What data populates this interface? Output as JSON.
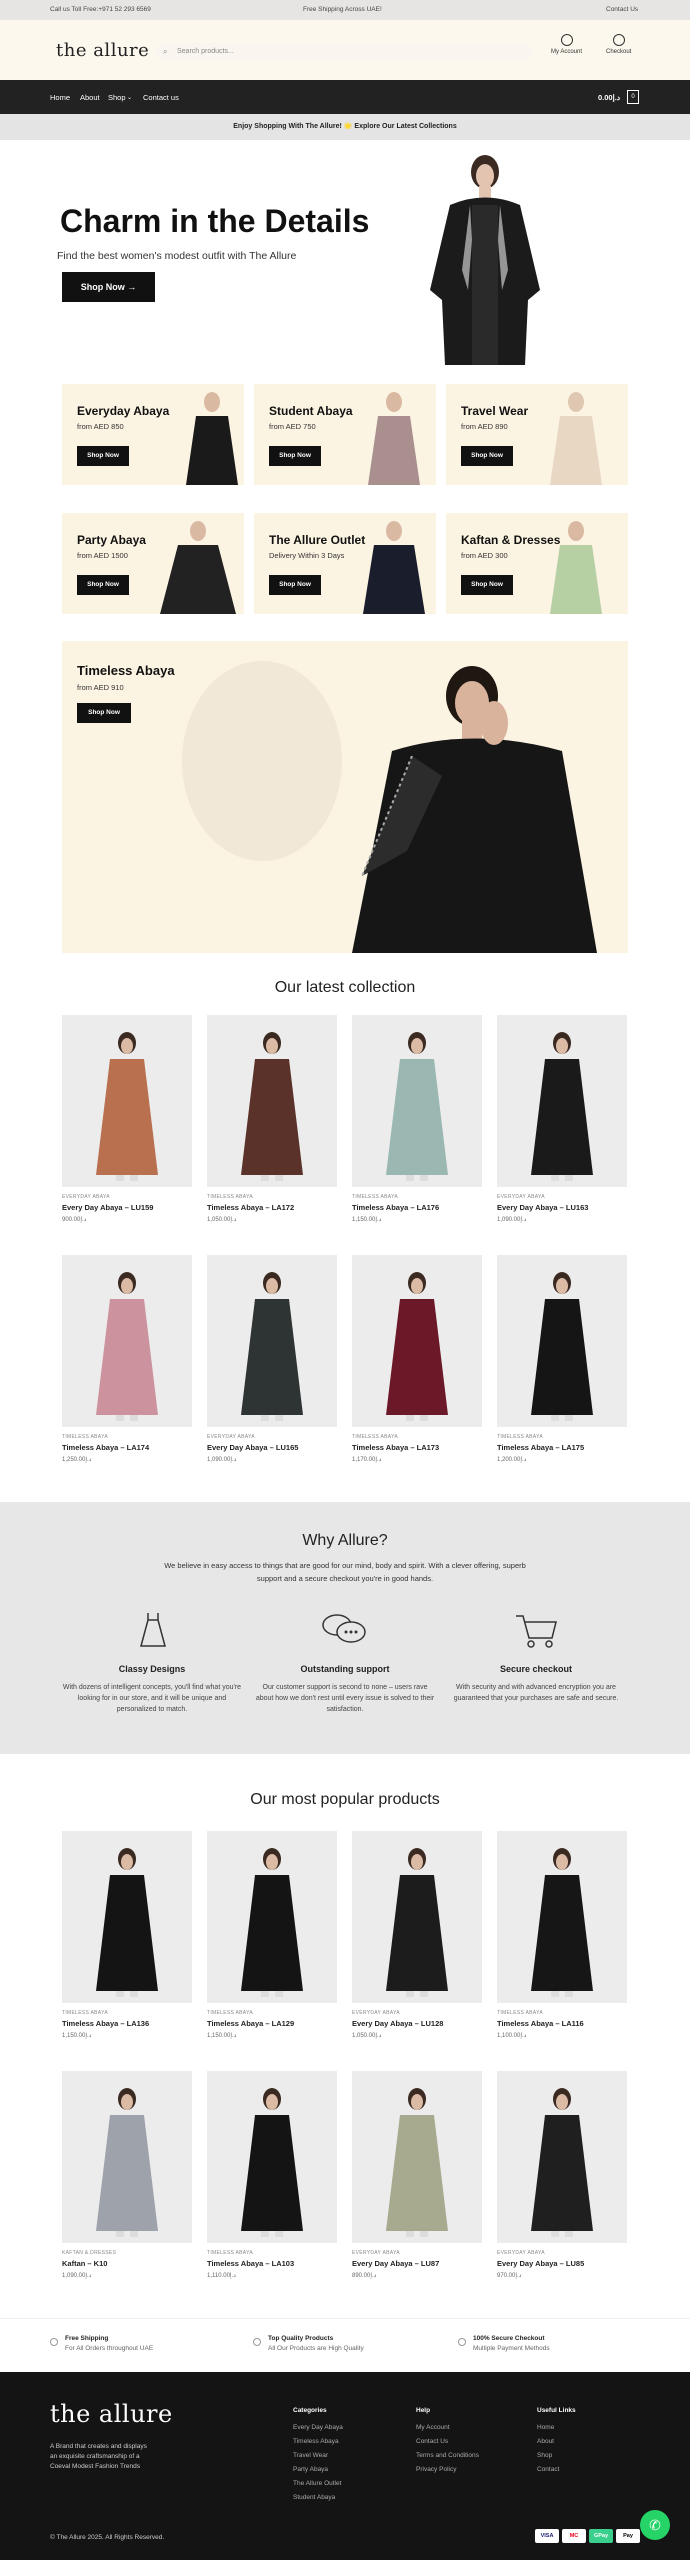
{
  "topbar": {
    "call": "Call us Toll Free:+971 52 293 6569",
    "shipping": "Free Shipping Across UAE!",
    "contact": "Contact Us"
  },
  "header": {
    "logo": "the allure",
    "search_placeholder": "Search products...",
    "account": "My Account",
    "checkout": "Checkout"
  },
  "nav": {
    "items": [
      "Home",
      "About",
      "Shop",
      "Contact us"
    ],
    "cart_total": "0.00د.إ",
    "cart_count": "0"
  },
  "notice": "Enjoy Shopping With The Allure! 🌟 Explore Our Latest Collections",
  "hero": {
    "title": "Charm in the Details",
    "subtitle": "Find the best women's modest outfit with The Allure",
    "button": "Shop Now →"
  },
  "categories": [
    {
      "title": "Everyday Abaya",
      "sub": "from AED 850",
      "btn": "Shop Now"
    },
    {
      "title": "Student Abaya",
      "sub": "from AED 750",
      "btn": "Shop Now"
    },
    {
      "title": "Travel Wear",
      "sub": "from AED 890",
      "btn": "Shop Now"
    },
    {
      "title": "Party Abaya",
      "sub": "from AED 1500",
      "btn": "Shop Now"
    },
    {
      "title": "The Allure Outlet",
      "sub": "Delivery Within 3 Days",
      "btn": "Shop Now"
    },
    {
      "title": "Kaftan & Dresses",
      "sub": "from AED 300",
      "btn": "Shop Now"
    }
  ],
  "big_banner": {
    "title": "Timeless Abaya",
    "sub": "from AED 910",
    "btn": "Shop Now"
  },
  "latest": {
    "title": "Our latest collection",
    "products": [
      {
        "cat": "Everyday Abaya",
        "name": "Every Day Abaya – LU159",
        "price": "900.00د.إ",
        "color": "#b8704f"
      },
      {
        "cat": "Timeless Abaya",
        "name": "Timeless Abaya – LA172",
        "price": "1,050.00د.إ",
        "color": "#5b3229"
      },
      {
        "cat": "Timeless Abaya",
        "name": "Timeless Abaya – LA176",
        "price": "1,150.00د.إ",
        "color": "#9bb7b1"
      },
      {
        "cat": "Everyday Abaya",
        "name": "Every Day Abaya – LU163",
        "price": "1,090.00د.إ",
        "color": "#1a1a1a"
      },
      {
        "cat": "Timeless Abaya",
        "name": "Timeless Abaya – LA174",
        "price": "1,250.00د.إ",
        "color": "#cc929d"
      },
      {
        "cat": "Everyday Abaya",
        "name": "Every Day Abaya – LU165",
        "price": "1,090.00د.إ",
        "color": "#2e3434"
      },
      {
        "cat": "Timeless Abaya",
        "name": "Timeless Abaya – LA173",
        "price": "1,170.00د.إ",
        "color": "#6b1828"
      },
      {
        "cat": "Timeless Abaya",
        "name": "Timeless Abaya – LA175",
        "price": "1,200.00د.إ",
        "color": "#151515"
      }
    ]
  },
  "why": {
    "title": "Why Allure?",
    "text": "We believe in easy access to things that are good for our mind, body and spirit. With a clever offering, superb support and a secure checkout you're in good hands.",
    "features": [
      {
        "title": "Classy Designs",
        "desc": "With dozens of intelligent concepts, you'll find what you're looking for in our store, and it will be unique and personalized to match."
      },
      {
        "title": "Outstanding support",
        "desc": "Our customer support is second to none – users rave about how we don't rest until every issue is solved to their satisfaction."
      },
      {
        "title": "Secure checkout",
        "desc": "With security and with advanced encryption you are guaranteed that your purchases are safe and secure."
      }
    ]
  },
  "popular": {
    "title": "Our most popular products",
    "products": [
      {
        "cat": "Timeless Abaya",
        "name": "Timeless Abaya – LA136",
        "price": "1,150.00د.إ",
        "color": "#141414"
      },
      {
        "cat": "Timeless Abaya",
        "name": "Timeless Abaya – LA129",
        "price": "1,150.00د.إ",
        "color": "#141414"
      },
      {
        "cat": "Everyday Abaya",
        "name": "Every Day Abaya – LU128",
        "price": "1,050.00د.إ",
        "color": "#1c1c1c"
      },
      {
        "cat": "Timeless Abaya",
        "name": "Timeless Abaya – LA116",
        "price": "1,100.00د.إ",
        "color": "#161616"
      },
      {
        "cat": "Kaftan & Dresses",
        "name": "Kaftan – K10",
        "price": "1,090.00د.إ",
        "color": "#9ea2aa"
      },
      {
        "cat": "Timeless Abaya",
        "name": "Timeless Abaya – LA103",
        "price": "1,110.00د.إ",
        "color": "#141414"
      },
      {
        "cat": "Everyday Abaya",
        "name": "Every Day Abaya – LU87",
        "price": "890.00د.إ",
        "color": "#a7aa8e"
      },
      {
        "cat": "Everyday Abaya",
        "name": "Every Day Abaya – LU85",
        "price": "970.00د.إ",
        "color": "#1f1f1f"
      }
    ]
  },
  "benefits": [
    {
      "title": "Free Shipping",
      "sub": "For All Orders throughout UAE"
    },
    {
      "title": "Top Quality Products",
      "sub": "All Our Products are High Quality"
    },
    {
      "title": "100% Secure Checkout",
      "sub": "Multiple Payment Methods"
    }
  ],
  "footer": {
    "logo": "the allure",
    "tagline": "A Brand that creates and displays an exquisite craftsmanship of a Coeval Modest Fashion Trends",
    "categories_title": "Categories",
    "categories": [
      "Every Day Abaya",
      "Timeless Abaya",
      "Travel Wear",
      "Party Abaya",
      "The Allure Outlet",
      "Student Abaya"
    ],
    "help_title": "Help",
    "help": [
      "My Account",
      "Contact Us",
      "Terms and Conditions",
      "Privacy Policy"
    ],
    "useful_title": "Useful Links",
    "useful": [
      "Home",
      "About",
      "Shop",
      "Contact"
    ],
    "copyright": "© The Allure 2025. All Rights Reserved.",
    "payments": [
      "VISA",
      "MC",
      "GPay",
      "Pay"
    ]
  }
}
